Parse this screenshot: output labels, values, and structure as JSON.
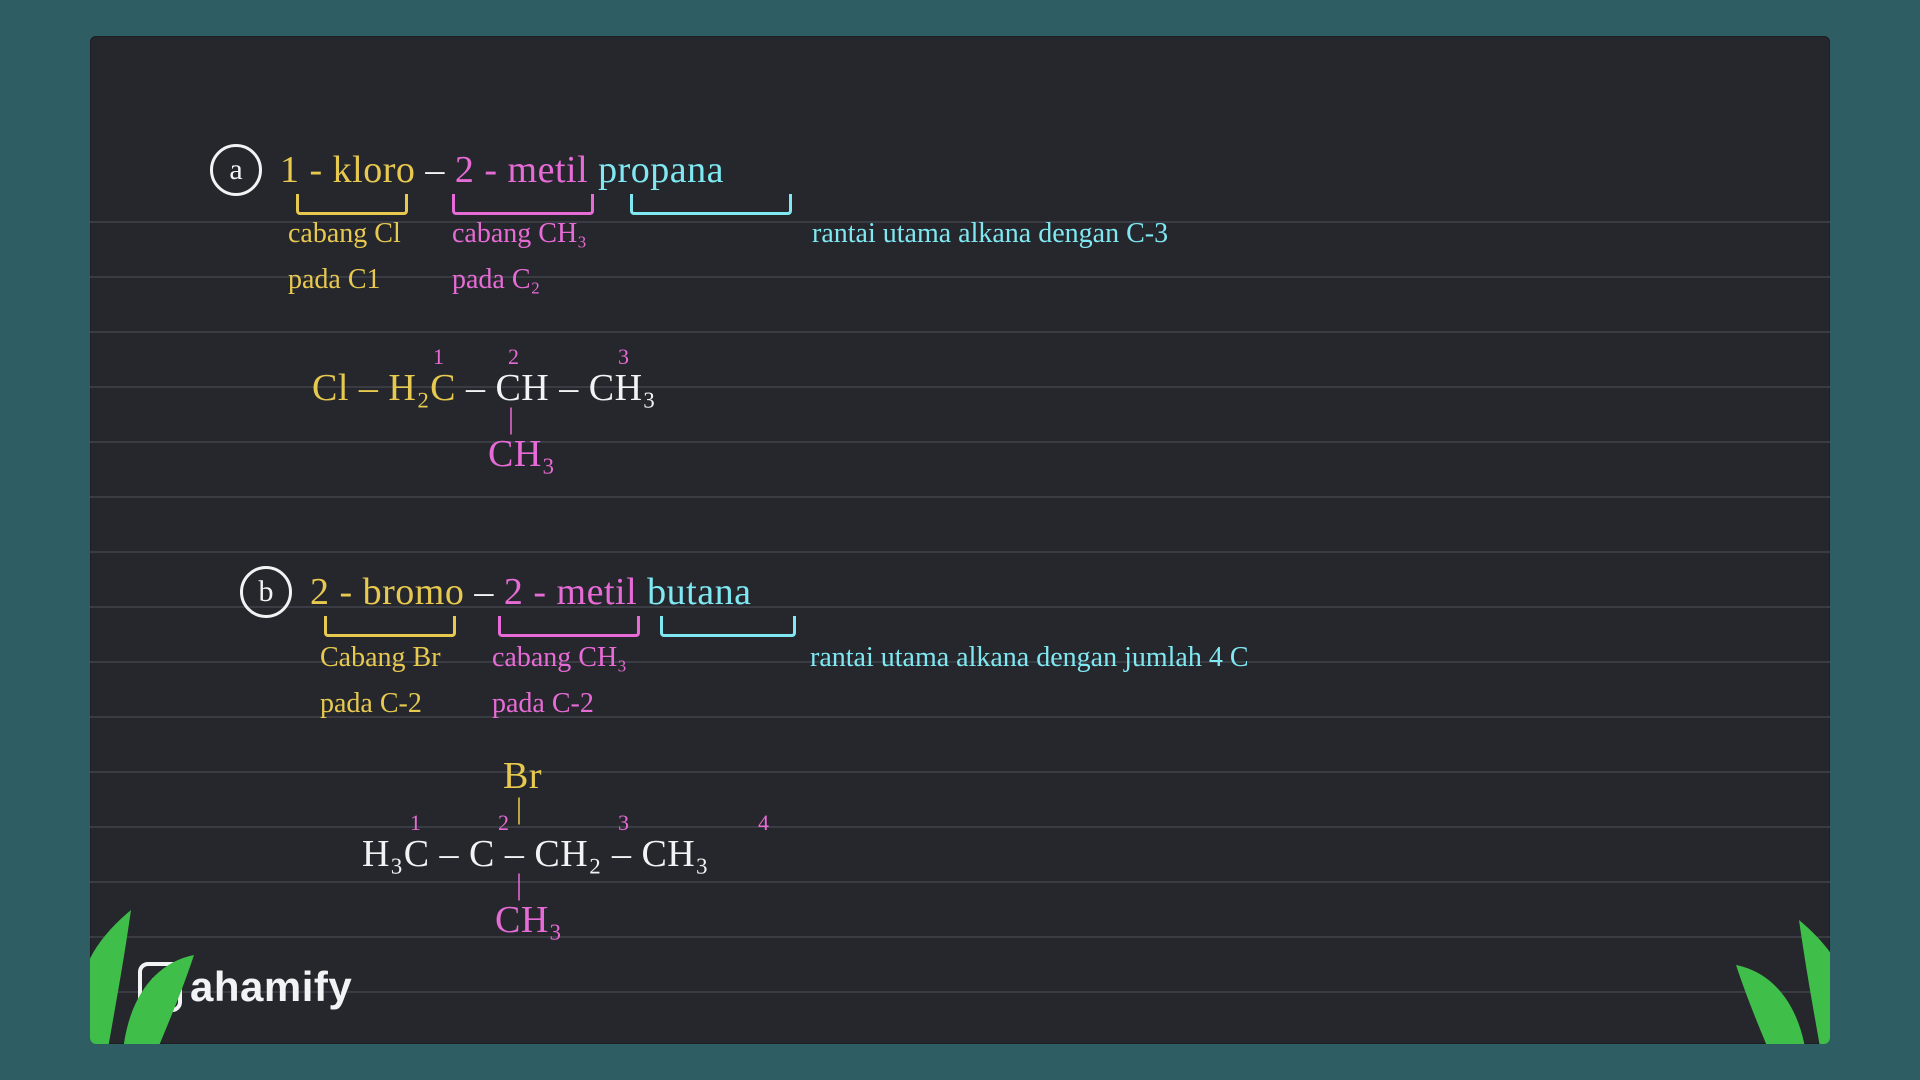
{
  "brand": "ahamify",
  "sectionA": {
    "badge": "a",
    "title_segments": {
      "kloro": "1 - kloro",
      "metil": "2 - metil",
      "prop": "propana"
    },
    "brackets": {
      "yellow": {
        "l1": "cabang Cl",
        "l2": "pada C1"
      },
      "magenta": {
        "l1": "cabang CH₃",
        "l2": "pada C₂"
      },
      "cyan": {
        "l1": "rantai utama alkana dengan C-3"
      }
    },
    "structure": {
      "nums": {
        "n1": "1",
        "n2": "2",
        "n3": "3"
      },
      "parts": {
        "cl": "Cl – H₂C",
        "c2": "– CH –",
        "c3": "CH₃",
        "branch": "CH₃"
      },
      "bond_vert": "|"
    }
  },
  "sectionB": {
    "badge": "b",
    "title_segments": {
      "bromo": "2 - bromo",
      "metil": "2 - metil",
      "but": "butana"
    },
    "brackets": {
      "yellow": {
        "l1": "Cabang Br",
        "l2": "pada C-2"
      },
      "magenta": {
        "l1": "cabang CH₃",
        "l2": "pada C-2"
      },
      "cyan": {
        "l1": "rantai utama alkana dengan jumlah 4 C"
      }
    },
    "structure": {
      "nums": {
        "n1": "1",
        "n2": "2",
        "n3": "3",
        "n4": "4"
      },
      "parts": {
        "c1": "H₃C –",
        "c2": "C",
        "c3": "– CH₂ –",
        "c4": "CH₃",
        "top": "Br",
        "bottom": "CH₃"
      },
      "bond_vert": "|"
    }
  }
}
